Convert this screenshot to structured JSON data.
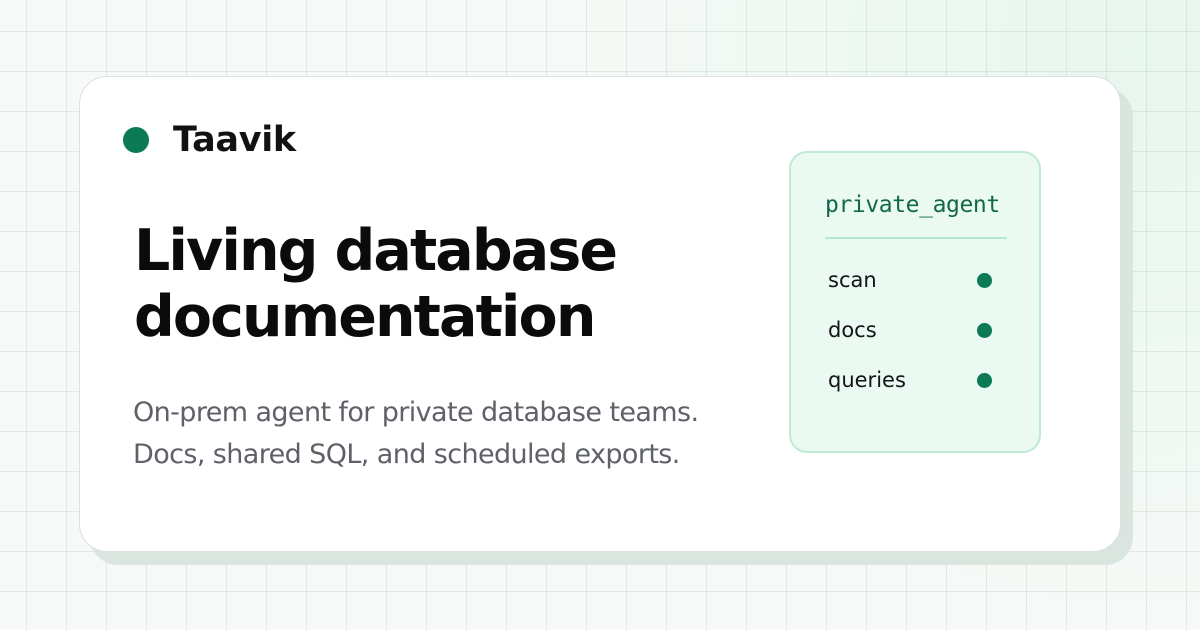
{
  "brand": {
    "name": "Taavik",
    "accent_color": "#0c7a55"
  },
  "hero": {
    "headline_lines": [
      "Living database",
      "documentation"
    ],
    "subtitle_lines": [
      "On-prem agent for private database teams.",
      "Docs, shared SQL, and scheduled exports."
    ]
  },
  "agent_panel": {
    "title": "private_agent",
    "items": [
      {
        "label": "scan",
        "status": "active",
        "status_color": "#0c7a55"
      },
      {
        "label": "docs",
        "status": "active",
        "status_color": "#0c7a55"
      },
      {
        "label": "queries",
        "status": "active",
        "status_color": "#0c7a55"
      }
    ]
  }
}
